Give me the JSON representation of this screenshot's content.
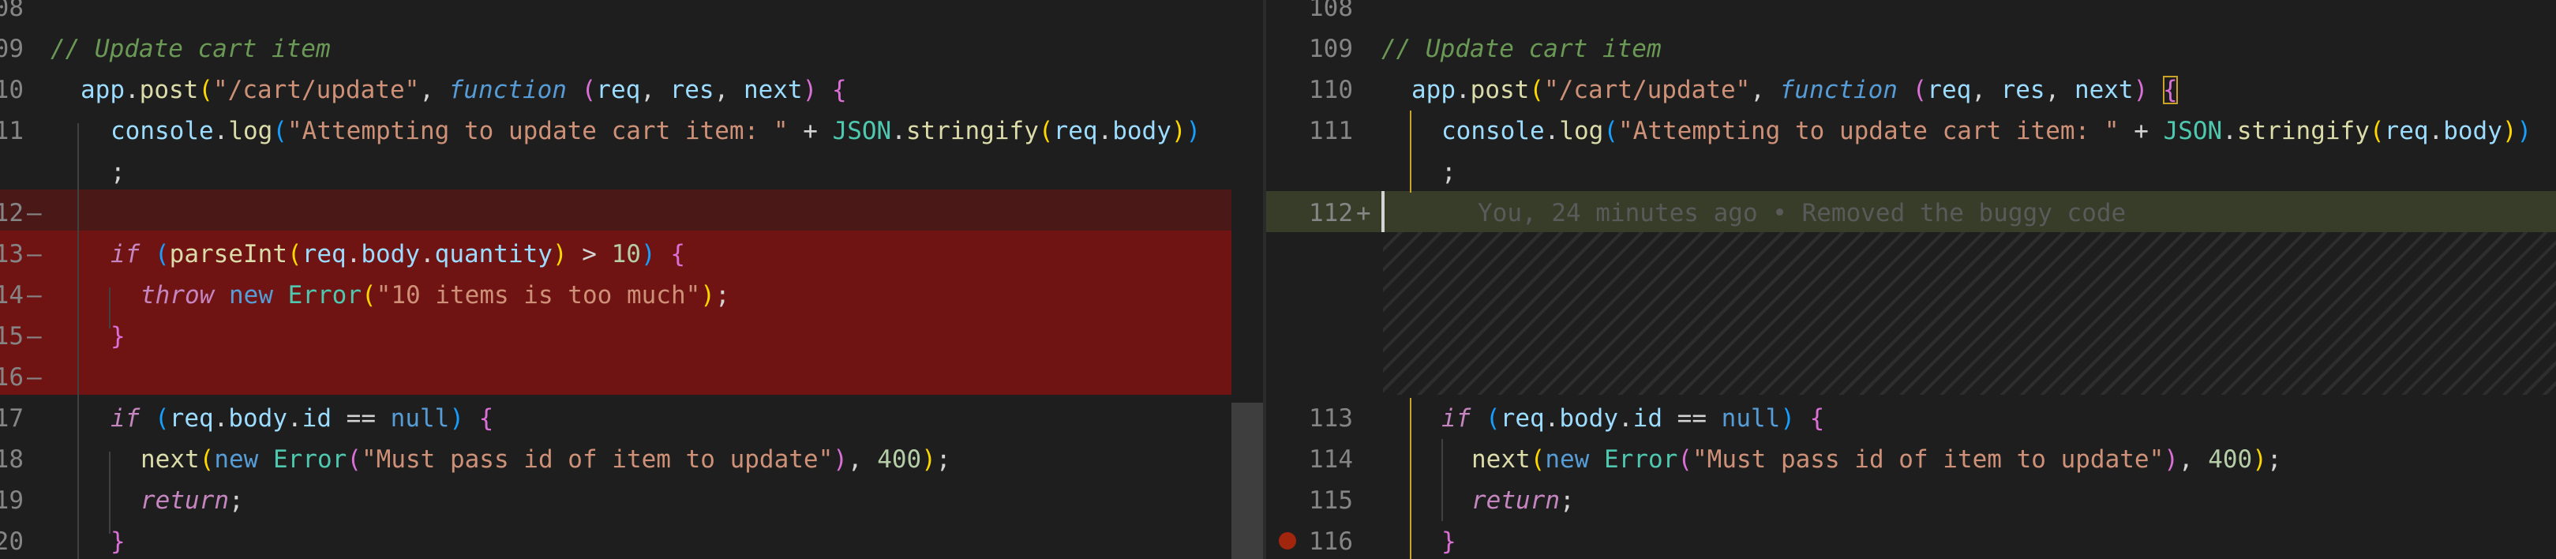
{
  "colors": {
    "deleted": "#6f1313",
    "deleted_soft": "#4b1818",
    "added": "#373d29",
    "breakpoint": "#a1260d"
  },
  "left": {
    "lines": [
      {
        "num": "08",
        "marker": ""
      },
      {
        "num": "09",
        "marker": ""
      },
      {
        "num": "10",
        "marker": ""
      },
      {
        "num": "11",
        "marker": ""
      },
      {
        "num": "",
        "marker": ""
      },
      {
        "num": "12",
        "marker": "—"
      },
      {
        "num": "13",
        "marker": "—"
      },
      {
        "num": "14",
        "marker": "—"
      },
      {
        "num": "15",
        "marker": "—"
      },
      {
        "num": "16",
        "marker": "—"
      },
      {
        "num": "17",
        "marker": ""
      },
      {
        "num": "18",
        "marker": ""
      },
      {
        "num": "19",
        "marker": ""
      },
      {
        "num": "20",
        "marker": ""
      }
    ],
    "code": {
      "comment": "// Update cart item",
      "app": "app",
      "post": "post",
      "route": "\"/cart/update\"",
      "function_kw": "function",
      "req": "req",
      "res": "res",
      "next": "next",
      "console": "console",
      "log": "log",
      "msg": "\"Attempting to update cart item: \"",
      "json": "JSON",
      "stringify": "stringify",
      "body": "body",
      "semi": ";",
      "if_kw": "if",
      "parseInt": "parseInt",
      "quantity": "quantity",
      "ten": "10",
      "throw_kw": "throw",
      "new_kw": "new",
      "error": "Error",
      "too_much": "\"10 items is too much\"",
      "id": "id",
      "null_kw": "null",
      "must_pass": "\"Must pass id of item to update\"",
      "four_hundred": "400",
      "return_kw": "return"
    }
  },
  "right": {
    "lines": [
      {
        "num": "108",
        "marker": ""
      },
      {
        "num": "109",
        "marker": ""
      },
      {
        "num": "110",
        "marker": ""
      },
      {
        "num": "111",
        "marker": ""
      },
      {
        "num": "",
        "marker": ""
      },
      {
        "num": "112",
        "marker": "+"
      },
      {
        "num": "",
        "marker": ""
      },
      {
        "num": "",
        "marker": ""
      },
      {
        "num": "",
        "marker": ""
      },
      {
        "num": "",
        "marker": ""
      },
      {
        "num": "113",
        "marker": ""
      },
      {
        "num": "114",
        "marker": ""
      },
      {
        "num": "115",
        "marker": ""
      },
      {
        "num": "116",
        "marker": ""
      }
    ],
    "blame": "You, 24 minutes ago • Removed the buggy code"
  }
}
